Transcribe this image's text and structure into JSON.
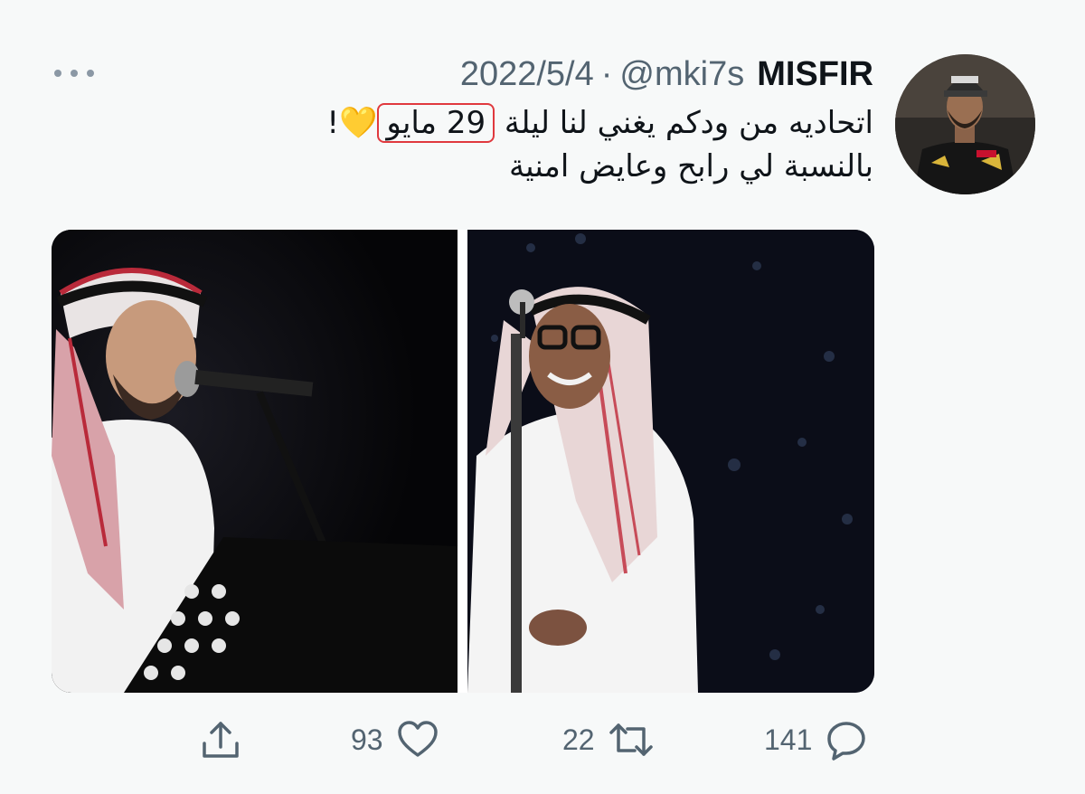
{
  "tweet": {
    "author_name": "MISFIR",
    "handle": "@mki7s",
    "separator": "·",
    "date": "2022/5/4",
    "text_part1": "اتحاديه من ودكم يغني لنا ليلة ",
    "text_highlight": "29 مايو",
    "text_emoji": "💛",
    "text_bang": "!",
    "text_line2": "بالنسبة لي رابح وعايض امنية"
  },
  "actions": {
    "replies": "141",
    "retweets": "22",
    "likes": "93"
  },
  "icons": {
    "more": "more-icon",
    "reply": "reply-icon",
    "retweet": "retweet-icon",
    "like": "heart-icon",
    "share": "share-icon"
  },
  "colors": {
    "background": "#f7f9f9",
    "text": "#0f1419",
    "muted": "#536471",
    "highlight_border": "#e0393e",
    "icon": "#536471"
  }
}
